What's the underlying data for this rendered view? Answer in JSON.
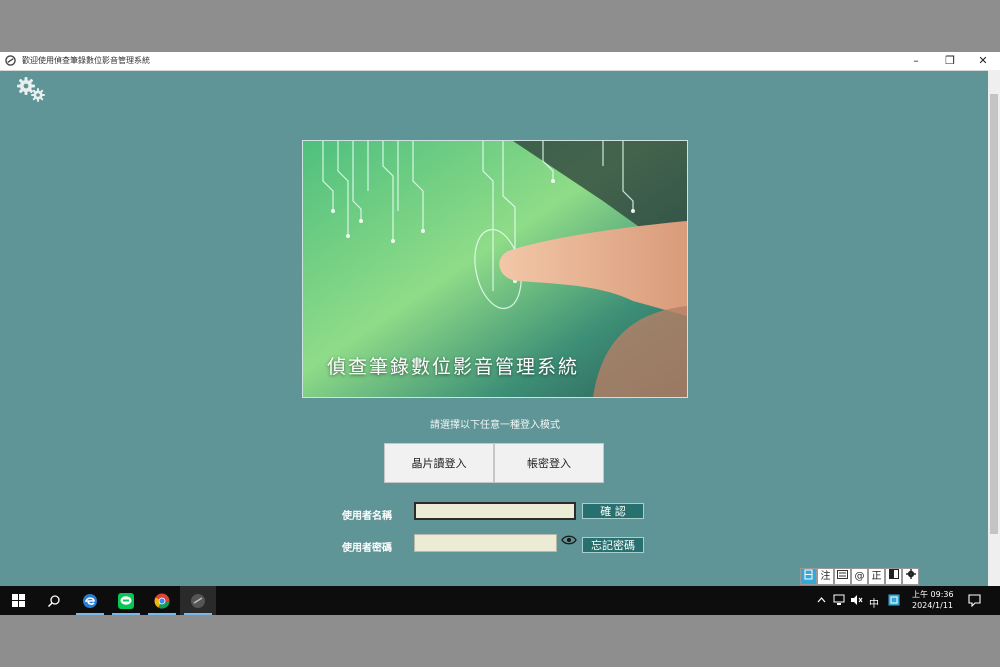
{
  "window": {
    "title": "歡迎使用偵查筆錄數位影音管理系統",
    "minimize_glyph": "–",
    "restore_glyph": "❐",
    "close_glyph": "✕"
  },
  "hero": {
    "title": "偵查筆錄數位影音管理系統"
  },
  "prompt": "請選擇以下任意一種登入模式",
  "login_modes": {
    "card_reader": "晶片讀登入",
    "password": "帳密登入"
  },
  "form": {
    "username_label": "使用者名稱",
    "password_label": "使用者密碼",
    "username_value": "",
    "password_value": "",
    "confirm_button": "確 認",
    "forgot_button": "忘記密碼"
  },
  "ime_bar": [
    "注",
    "@",
    "正"
  ],
  "taskbar": {
    "ime_indicator": "中",
    "time": "上午 09:36",
    "date": "2024/1/11"
  },
  "colors": {
    "background": "#5f9596",
    "button": "#28706f",
    "field": "#ecebd6"
  }
}
